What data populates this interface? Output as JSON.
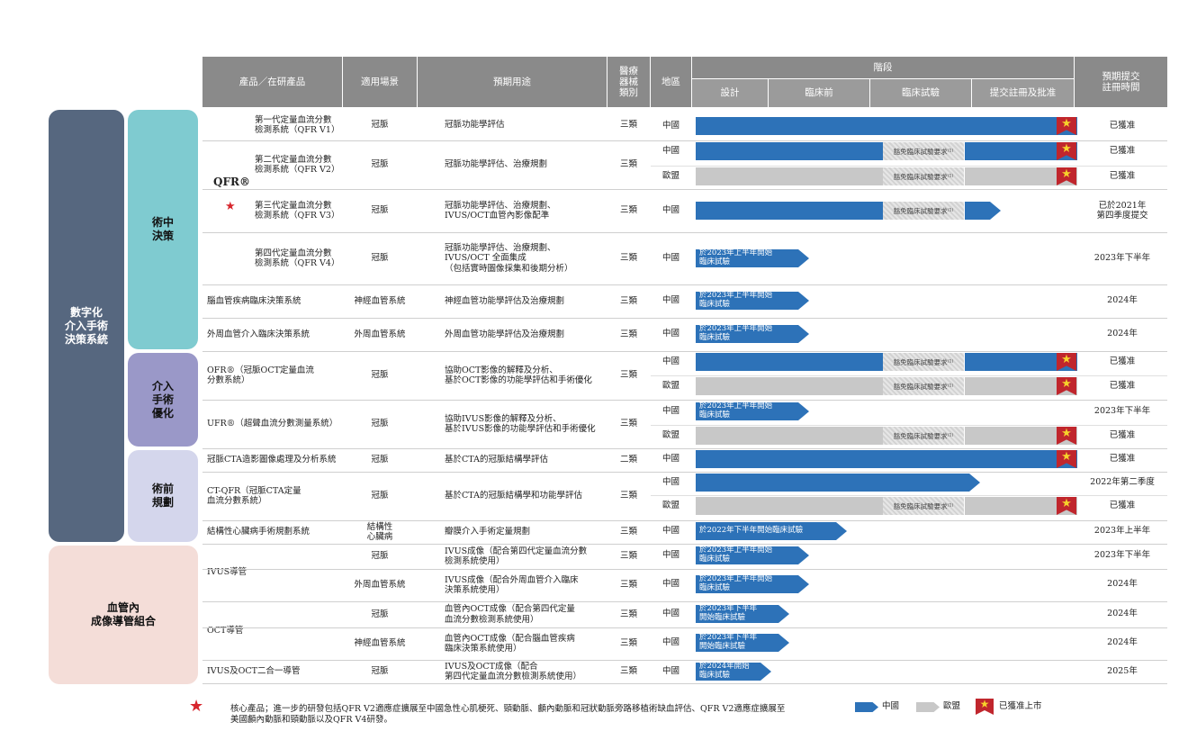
{
  "header": {
    "product": "產品／在研產品",
    "scenario": "適用場景",
    "use": "預期用途",
    "device_class": "醫療\n器械\n類別",
    "region": "地區",
    "stage": "階段",
    "stage_design": "設計",
    "stage_preclinical": "臨床前",
    "stage_clinical": "臨床試驗",
    "stage_approval": "提交註冊及批准",
    "expected": "預期提交\n註冊時間"
  },
  "categories": {
    "digital": "數字化\n介入手術\n決策系統",
    "intraop": "術中\n決策",
    "optimize": "介入\n手術\n優化",
    "planning": "術前\n規劃",
    "imaging": "血管內\n成像導管組合"
  },
  "qfr_group": {
    "label": "QFR®",
    "star": "★"
  },
  "rows": [
    {
      "product": "第一代定量血流分數\n檢測系統（QFR V1）",
      "scenario": "冠脈",
      "use": "冠脈功能學評估",
      "class": "三類",
      "regions": [
        "中國"
      ],
      "expected": [
        "已獲准"
      ]
    },
    {
      "product": "第二代定量血流分數\n檢測系統（QFR V2）",
      "scenario": "冠脈",
      "use": "冠脈功能學評估、治療規劃",
      "class": "三類",
      "regions": [
        "中國",
        "歐盟"
      ],
      "expected": [
        "已獲准",
        "已獲准"
      ]
    },
    {
      "product": "第三代定量血流分數\n檢測系統（QFR V3）",
      "scenario": "冠脈",
      "use": "冠脈功能學評估、治療規劃、\nIVUS/OCT血管內影像配準",
      "class": "三類",
      "regions": [
        "中國"
      ],
      "expected": [
        "已於2021年\n第四季度提交"
      ]
    },
    {
      "product": "第四代定量血流分數\n檢測系統（QFR V4）",
      "scenario": "冠脈",
      "use": "冠脈功能學評估、治療規劃、\nIVUS/OCT 全面集成\n（包括實時圖像採集和後期分析）",
      "class": "三類",
      "regions": [
        "中國"
      ],
      "expected": [
        "2023年下半年"
      ]
    },
    {
      "product": "腦血管疾病臨床決策系統",
      "scenario": "神經血管系統",
      "use": "神經血管功能學評估及治療規劃",
      "class": "三類",
      "regions": [
        "中國"
      ],
      "expected": [
        "2024年"
      ]
    },
    {
      "product": "外周血管介入臨床決策系統",
      "scenario": "外周血管系統",
      "use": "外周血管功能學評估及治療規劃",
      "class": "三類",
      "regions": [
        "中國"
      ],
      "expected": [
        "2024年"
      ]
    },
    {
      "product": "OFR®（冠脈OCT定量血流\n分數系統）",
      "scenario": "冠脈",
      "use": "協助OCT影像的解釋及分析、\n基於OCT影像的功能學評估和手術優化",
      "class": "三類",
      "regions": [
        "中國",
        "歐盟"
      ],
      "expected": [
        "已獲准",
        "已獲准"
      ]
    },
    {
      "product": "UFR®（超聲血流分數測量系統）",
      "scenario": "冠脈",
      "use": "協助IVUS影像的解釋及分析、\n基於IVUS影像的功能學評估和手術優化",
      "class": "三類",
      "regions": [
        "中國",
        "歐盟"
      ],
      "expected": [
        "2023年下半年",
        "已獲准"
      ]
    },
    {
      "product": "冠脈CTA造影圖像處理及分析系統",
      "scenario": "冠脈",
      "use": "基於CTA的冠脈結構學評估",
      "class": "二類",
      "regions": [
        "中國"
      ],
      "expected": [
        "已獲准"
      ]
    },
    {
      "product": "CT-QFR（冠脈CTA定量\n血流分數系統）",
      "scenario": "冠脈",
      "use": "基於CTA的冠脈結構學和功能學評估",
      "class": "三類",
      "regions": [
        "中國",
        "歐盟"
      ],
      "expected": [
        "2022年第二季度",
        "已獲准"
      ]
    },
    {
      "product": "結構性心臟病手術規劃系統",
      "scenario": "結構性\n心臟病",
      "use": "瓣膜介入手術定量規劃",
      "class": "三類",
      "regions": [
        "中國"
      ],
      "expected": [
        "2023年上半年"
      ]
    },
    {
      "product": "IVUS導管",
      "scenario": "冠脈",
      "use": "IVUS成像（配合第四代定量血流分數\n檢測系統使用）",
      "class": "三類",
      "regions": [
        "中國"
      ],
      "expected": [
        "2023年下半年"
      ]
    },
    {
      "product": "",
      "scenario": "外周血管系統",
      "use": "IVUS成像（配合外周血管介入臨床\n決策系統使用）",
      "class": "三類",
      "regions": [
        "中國"
      ],
      "expected": [
        "2024年"
      ]
    },
    {
      "product": "OCT導管",
      "scenario": "冠脈",
      "use": "血管內OCT成像（配合第四代定量\n血流分數檢測系統使用）",
      "class": "三類",
      "regions": [
        "中國"
      ],
      "expected": [
        "2024年"
      ]
    },
    {
      "product": "",
      "scenario": "神經血管系統",
      "use": "血管內OCT成像（配合腦血管疾病\n臨床決策系統使用）",
      "class": "三類",
      "regions": [
        "中國"
      ],
      "expected": [
        "2024年"
      ]
    },
    {
      "product": "IVUS及OCT二合一導管",
      "scenario": "冠脈",
      "use": "IVUS及OCT成像（配合\n第四代定量血流分數檢測系統使用）",
      "class": "三類",
      "regions": [
        "中國"
      ],
      "expected": [
        "2025年"
      ]
    }
  ],
  "bar_text": {
    "exempt": "豁免臨床試驗要求⁽¹⁾",
    "start_2023h1": "於2023年上半年開始\n臨床試驗",
    "start_2022h2": "於2022年下半年開始臨床試驗",
    "start_2023h2": "於2023年下半年\n開始臨床試驗",
    "start_2024": "於2024年開始\n臨床試驗"
  },
  "colors": {
    "header": "#8a8a8a",
    "china_bar": "#2d72b8",
    "eu_bar": "#c8c8c8",
    "approved": "#c0262d",
    "digital": "#56677f",
    "intraop": "#7fcbd0",
    "optimize": "#9a98c8",
    "planning": "#d4d6ec",
    "imaging": "#f4ddd8"
  },
  "footer": {
    "star": "★",
    "note": "核心產品；進一步的研發包括QFR V2適應症擴展至中國急性心肌梗死、頸動脈、顱內動脈和冠狀動脈旁路移植術缺血評估、QFR V2適應症擴展至\n美國顱內動脈和頸動脈以及QFR V4研發。",
    "legend_china": "中國",
    "legend_eu": "歐盟",
    "legend_approved": "已獲准上市"
  }
}
